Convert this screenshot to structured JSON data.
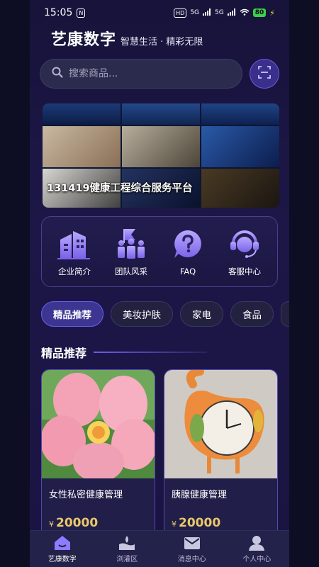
{
  "status_bar": {
    "time": "15:05",
    "app_badge": "N",
    "network_hd": "HD",
    "network_1": "5G",
    "network_2": "5G",
    "battery": "80"
  },
  "header": {
    "brand": "艺康数字",
    "slogan": "智慧生活 · 精彩无限"
  },
  "search": {
    "placeholder": "搜索商品..."
  },
  "banner": {
    "title": "131419健康工程综合服务平台"
  },
  "quick_menu": {
    "items": [
      {
        "label": "企业简介",
        "icon": "building-icon"
      },
      {
        "label": "团队风采",
        "icon": "team-icon"
      },
      {
        "label": "FAQ",
        "icon": "faq-icon"
      },
      {
        "label": "客服中心",
        "icon": "customer-service-icon"
      }
    ]
  },
  "categories": {
    "items": [
      "精品推荐",
      "美妆护肤",
      "家电",
      "食品"
    ],
    "active_index": 0
  },
  "section": {
    "title": "精品推荐"
  },
  "products": [
    {
      "name": "女性私密健康管理",
      "currency": "¥",
      "price": "20000"
    },
    {
      "name": "胰腺健康管理",
      "currency": "¥",
      "price": "20000"
    }
  ],
  "bottom_nav": {
    "items": [
      {
        "label": "艺康数字",
        "icon": "home-icon"
      },
      {
        "label": "浏灌区",
        "icon": "water-icon"
      },
      {
        "label": "消息中心",
        "icon": "mail-icon"
      },
      {
        "label": "个人中心",
        "icon": "person-icon"
      }
    ],
    "active_index": 0
  },
  "colors": {
    "accent": "#6a5ff0",
    "price": "#e9c86a",
    "background": "#17133a"
  }
}
